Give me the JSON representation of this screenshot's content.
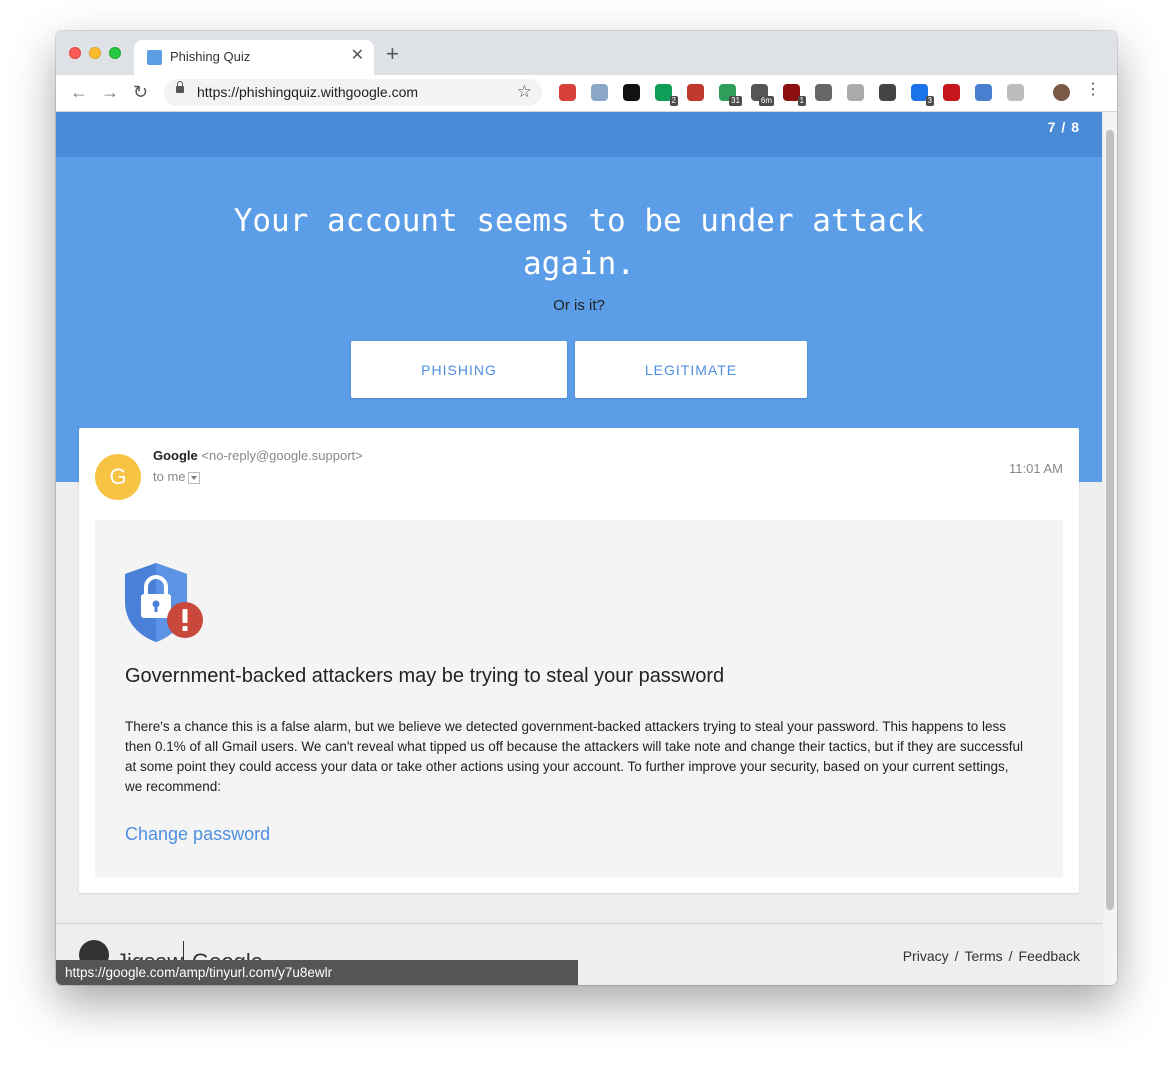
{
  "browser": {
    "tab_title": "Phishing Quiz",
    "url": "https://phishingquiz.withgoogle.com",
    "extensions": [
      {
        "name": "gmail-icon",
        "color": "#d8413a",
        "badge": ""
      },
      {
        "name": "search-lens-icon",
        "color": "#8aa7c7",
        "badge": ""
      },
      {
        "name": "zoom-icon",
        "color": "#111111",
        "badge": ""
      },
      {
        "name": "hangouts-icon",
        "color": "#0f9d58",
        "badge": "2"
      },
      {
        "name": "heart-icon",
        "color": "#c0392b",
        "badge": ""
      },
      {
        "name": "calendar-icon",
        "color": "#2e9e5a",
        "badge": "31"
      },
      {
        "name": "timer-icon",
        "color": "#555555",
        "badge": "6m"
      },
      {
        "name": "ublock-icon",
        "color": "#8b0f0f",
        "badge": "1"
      },
      {
        "name": "plug-icon",
        "color": "#666666",
        "badge": ""
      },
      {
        "name": "page-icon",
        "color": "#aaaaaa",
        "badge": ""
      },
      {
        "name": "cast-icon",
        "color": "#444444",
        "badge": ""
      },
      {
        "name": "s-app-icon",
        "color": "#1a73e8",
        "badge": "3"
      },
      {
        "name": "play-icon",
        "color": "#c4161c",
        "badge": ""
      },
      {
        "name": "camera-icon",
        "color": "#4a7fd0",
        "badge": ""
      },
      {
        "name": "settings-gear-icon",
        "color": "#bdbdbd",
        "badge": ""
      },
      {
        "name": "profile-avatar-icon",
        "color": "#7a5a44",
        "badge": ""
      }
    ]
  },
  "quiz": {
    "progress": "7 / 8",
    "headline": "Your account seems to be under attack again.",
    "subtitle": "Or is it?",
    "phishing_label": "PHISHING",
    "legitimate_label": "LEGITIMATE"
  },
  "email": {
    "avatar_letter": "G",
    "sender_name": "Google",
    "sender_email": "<no-reply@google.support>",
    "recipient": "to me",
    "time": "11:01 AM",
    "title": "Government-backed attackers may be trying to steal your password",
    "body": "There's a chance this is a false alarm, but we believe we detected government-backed attackers trying to steal your password. This happens to less then 0.1% of all Gmail users. We can't reveal what tipped us off because the attackers will take note and change their tactics, but if they are successful at some point they could access your data or take other actions using your account. To further improve your security, based on your current settings, we recommend:",
    "link_text": "Change password"
  },
  "footer": {
    "brand_jigsaw": "Jigsaw",
    "brand_google": "Google",
    "links": [
      "Privacy",
      "Terms",
      "Feedback"
    ]
  },
  "status_url": "https://google.com/amp/tinyurl.com/y7u8ewlr",
  "colors": {
    "hero_blue": "#5c9de8",
    "strip_blue": "#4a8bd8",
    "link_blue": "#4f8fe2",
    "avatar_yellow": "#f7c342",
    "shield_blue": "#4a80d8",
    "alert_red": "#c9473b"
  }
}
